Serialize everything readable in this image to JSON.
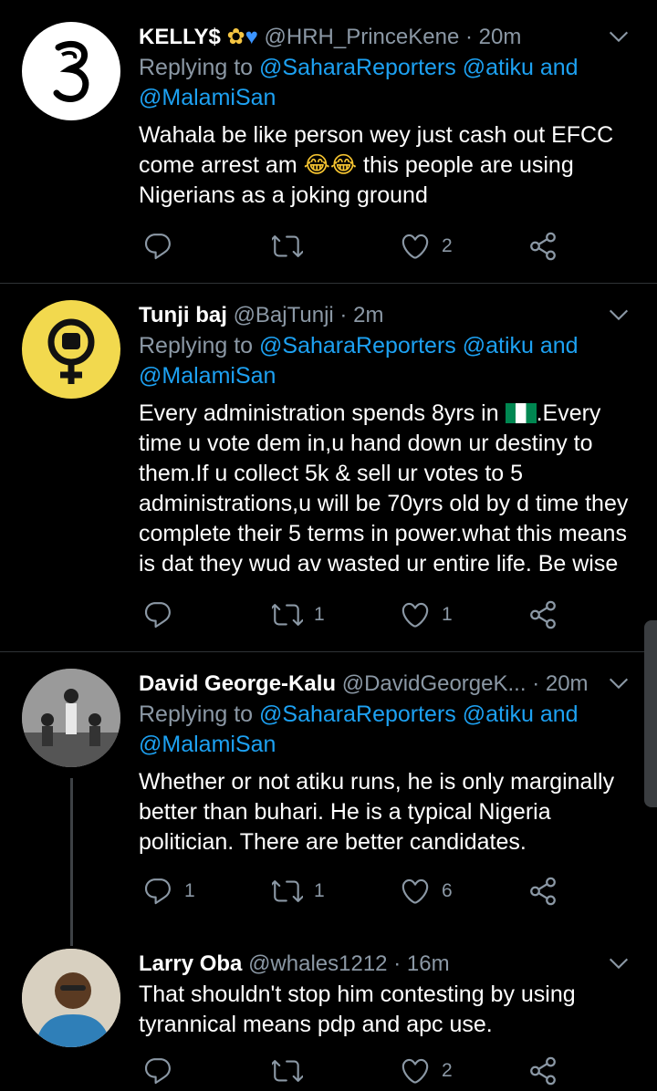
{
  "tweets": [
    {
      "name": "KELLY$",
      "handle": "@HRH_PrinceKene",
      "time": "20m",
      "replying_prefix": "Replying to",
      "replying_mentions": "@SaharaReporters @atiku and",
      "replying_mentions2": "@MalamiSan",
      "body_1": "Wahala be like person wey just cash out EFCC",
      "body_2a": "come arrest am",
      "body_2b": "this people are using",
      "body_3": "Nigerians as a joking ground",
      "reply_count": "",
      "retweet_count": "",
      "like_count": "2"
    },
    {
      "name": "Tunji baj",
      "handle": "@BajTunji",
      "time": "2m",
      "replying_prefix": "Replying to",
      "replying_mentions": "@SaharaReporters @atiku and",
      "replying_mentions2": "@MalamiSan",
      "body_1a": "Every administration spends 8yrs in",
      "body_1b": ".Every",
      "body_2": "time u vote dem in,u hand down ur destiny to",
      "body_3": "them.If u collect 5k & sell ur votes to 5",
      "body_4": "administrations,u will be 70yrs old by d time they",
      "body_5": "complete their 5 terms in power.what this means",
      "body_6": "is dat they wud av wasted ur entire life. Be wise",
      "reply_count": "",
      "retweet_count": "1",
      "like_count": "1"
    },
    {
      "name": "David George-Kalu",
      "handle": "@DavidGeorgeK...",
      "time": "20m",
      "replying_prefix": "Replying to",
      "replying_mentions": "@SaharaReporters @atiku and",
      "replying_mentions2": "@MalamiSan",
      "body_1": "Whether or not atiku runs, he is only marginally",
      "body_2": "better than buhari. He is a typical Nigeria",
      "body_3": "politician. There are better candidates.",
      "reply_count": "1",
      "retweet_count": "1",
      "like_count": "6"
    },
    {
      "name": "Larry Oba",
      "handle": "@whales1212",
      "time": "16m",
      "body_1": "That shouldn't stop him contesting by using",
      "body_2": "tyrannical means pdp and apc use.",
      "reply_count": "",
      "retweet_count": "",
      "like_count": "2"
    }
  ],
  "colors": {
    "background": "#000000",
    "mention": "#1da1f2",
    "secondary_text": "#8b98a5",
    "divider": "#2f3336"
  },
  "icons": [
    "reply-icon",
    "retweet-icon",
    "like-icon",
    "share-icon",
    "chevron-down-icon"
  ]
}
